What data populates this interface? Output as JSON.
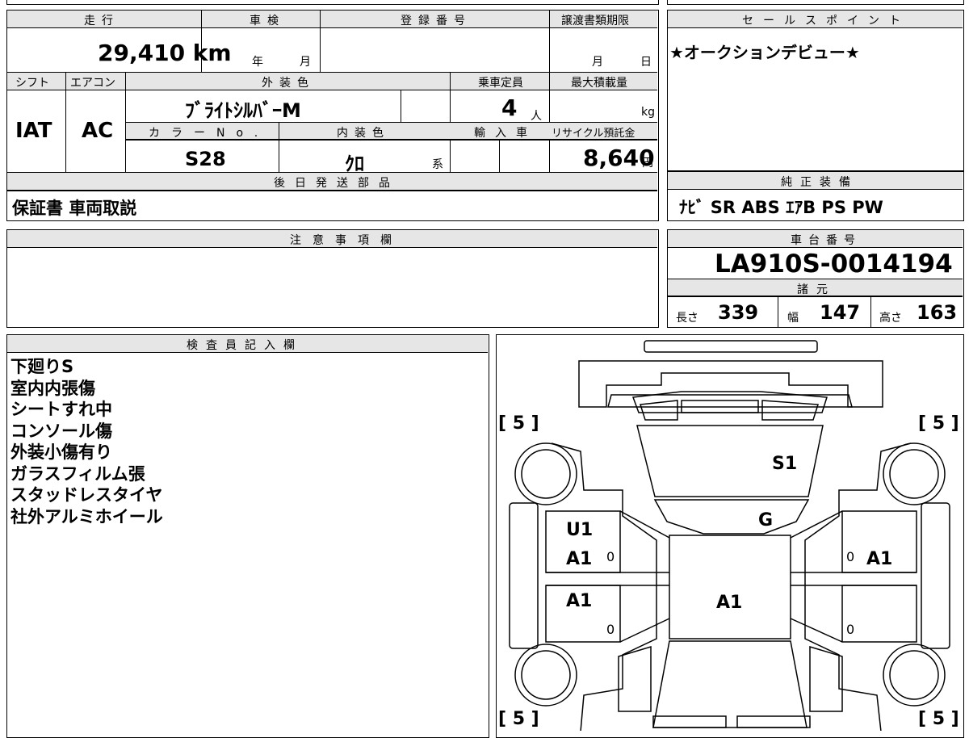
{
  "top_info": {
    "headers": {
      "mileage": "走行",
      "inspection": "車検",
      "registration": "登録番号",
      "transfer_deadline": "譲渡書類期限",
      "shift": "シフト",
      "aircon": "エアコン",
      "exterior_color": "外装色",
      "capacity": "乗車定員",
      "max_load": "最大積載量",
      "color_no": "カラーNo.",
      "interior_color": "内装色",
      "import": "輸入車",
      "recycle": "リサイクル預託金",
      "later_parts": "後日発送部品"
    },
    "mileage_value": "29,410 km",
    "inspection_year": "年",
    "inspection_month": "月",
    "deadline_month": "月",
    "deadline_day": "日",
    "shift_value": "IAT",
    "aircon_value": "AC",
    "exterior_color_value": "ﾌﾞﾗｲﾄｼﾙﾊﾞｰM",
    "capacity_value": "4",
    "capacity_unit": "人",
    "load_unit": "kg",
    "color_no_value": "S28",
    "interior_color_value": "ｸﾛ",
    "interior_color_suffix": "系",
    "recycle_value": "8,640",
    "recycle_unit": "円",
    "later_parts_value": "保証書 車両取説"
  },
  "sales_point": {
    "header": "セールスポイント",
    "text": "★オークションデビュー★"
  },
  "equipment": {
    "header": "純正装備",
    "items": "ﾅﾋﾞ  SR  ABS  ｴｱB  PS  PW"
  },
  "notes": {
    "header": "注意事項欄"
  },
  "chassis": {
    "header": "車台番号",
    "number": "LA910S-0014194"
  },
  "specs": {
    "header": "諸元",
    "length_label": "長さ",
    "length": "339",
    "width_label": "幅",
    "width": "147",
    "height_label": "高さ",
    "height": "163"
  },
  "inspector": {
    "header": "検査員記入欄",
    "lines": [
      "下廻りS",
      "室内内張傷",
      "シートすれ中",
      "コンソール傷",
      "外装小傷有り",
      "ガラスフィルム張",
      "スタッドレスタイヤ",
      "社外アルミホイール"
    ]
  },
  "diagram": {
    "tire_marks": [
      "[ 5 ]",
      "[ 5 ]",
      "[ 5 ]",
      "[ 5 ]"
    ],
    "damage_codes": {
      "windshield": "S1",
      "hood": "G",
      "front_left_door_1": "U1",
      "front_left_door_2": "A1",
      "rear_left_door": "A1",
      "roof": "A1",
      "front_right_door": "A1"
    },
    "zero_marks": [
      "0",
      "0",
      "0",
      "0"
    ]
  }
}
